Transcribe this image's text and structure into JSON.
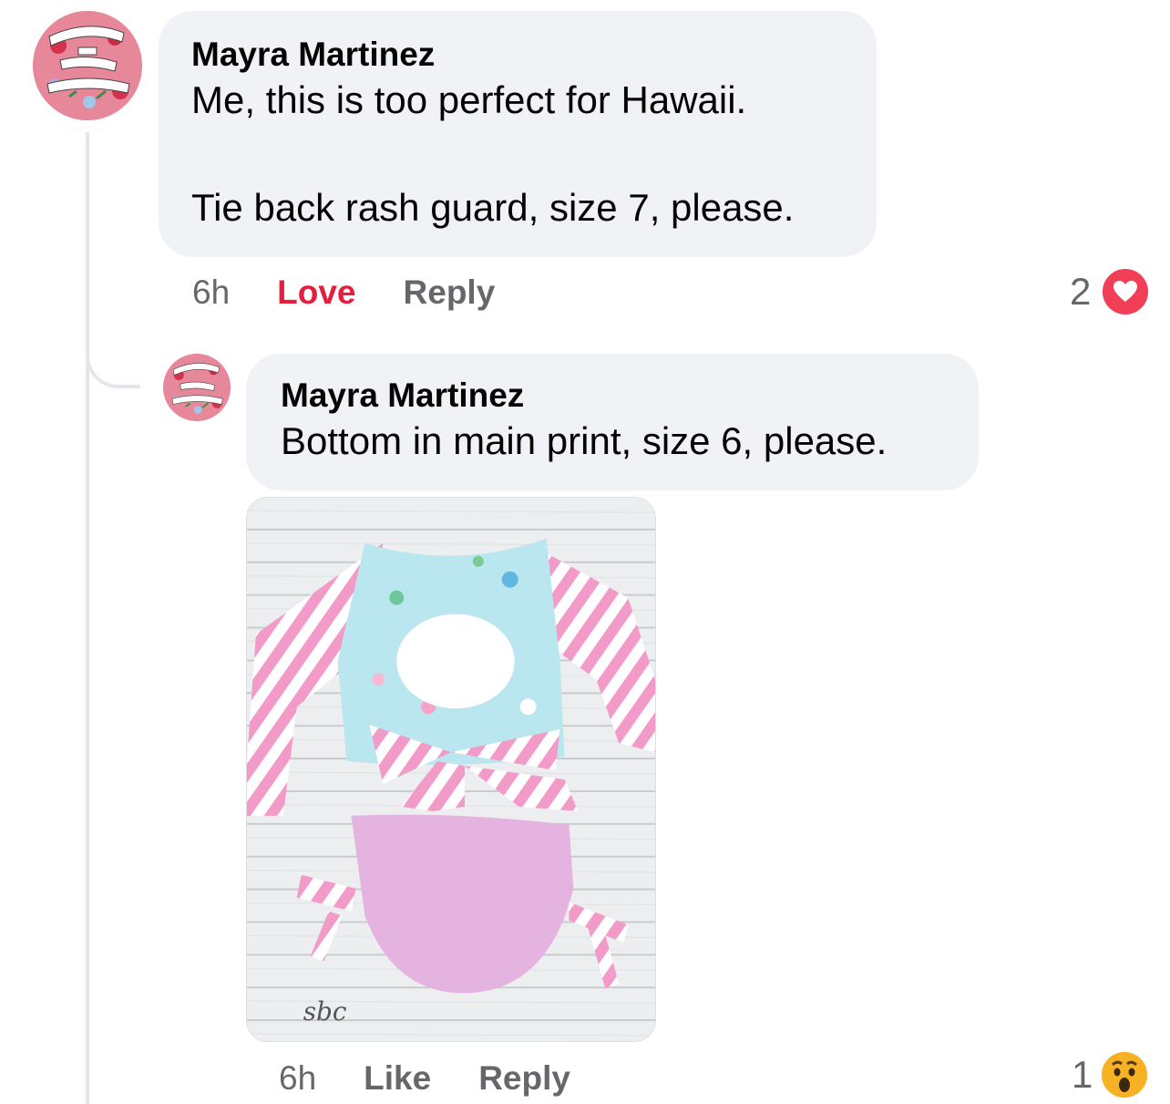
{
  "comments": [
    {
      "author": "Mayra Martinez",
      "text_lines": [
        "Me, this is too perfect for Hawaii.",
        "Tie back rash guard, size 7, please."
      ],
      "time": "6h",
      "action_primary": "Love",
      "action_reply": "Reply",
      "reaction_count": "2",
      "reaction_icon": "heart-icon",
      "avatar_text": [
        "NOLITE",
        "TE",
        "BASTARDES",
        "CARBORUNDORUM"
      ]
    },
    {
      "author": "Mayra Martinez",
      "text_lines": [
        "Bottom in main print, size 6, please."
      ],
      "time": "6h",
      "action_primary": "Like",
      "action_reply": "Reply",
      "reaction_count": "1",
      "reaction_icon": "wow-face-icon",
      "avatar_text": [
        "NOLITE",
        "TE",
        "BASTARDES",
        "CARBORUNDORUM"
      ],
      "photo_watermark": "sbc"
    }
  ],
  "colors": {
    "bubble": "#f0f2f5",
    "muted_text": "#65676b",
    "love_red": "#e41e3f",
    "heart_badge": "#f33e58",
    "wow_badge": "#f7b125"
  }
}
